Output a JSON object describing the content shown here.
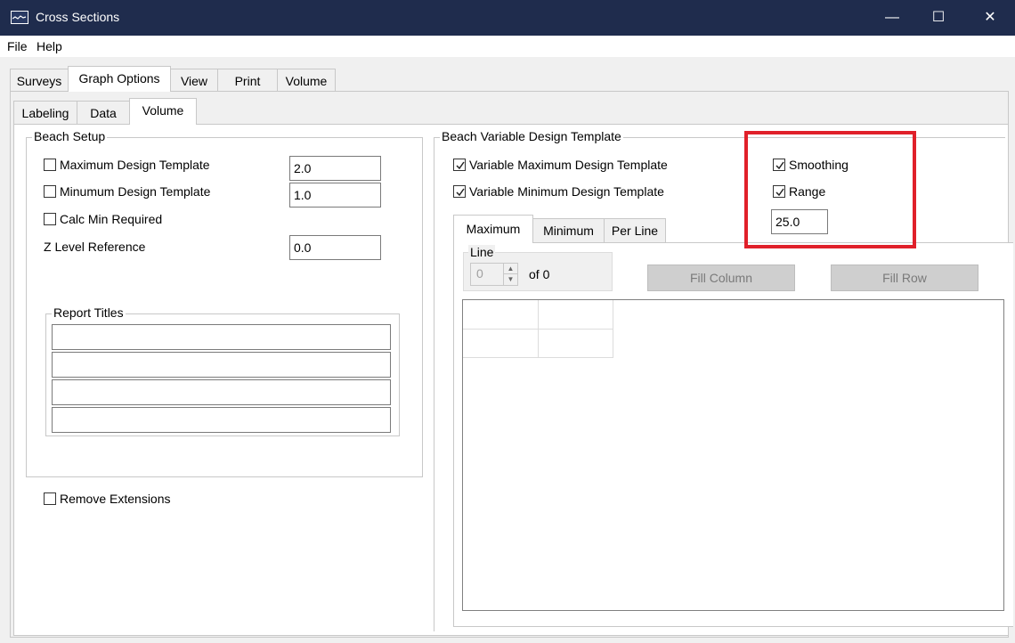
{
  "window": {
    "title": "Cross Sections",
    "minimize": "—",
    "maximize": "☐",
    "close": "✕"
  },
  "menu": [
    "File",
    "Help"
  ],
  "main_tabs": [
    "Surveys",
    "Graph Options",
    "View",
    "Print",
    "Volume"
  ],
  "sub_tabs": [
    "Labeling",
    "Data",
    "Volume"
  ],
  "beach_setup": {
    "legend": "Beach Setup",
    "max_design": {
      "label": "Maximum Design Template",
      "checked": false,
      "value": "2.0"
    },
    "min_design": {
      "label": "Minumum Design Template",
      "checked": false,
      "value": "1.0"
    },
    "calc_min": {
      "label": "Calc Min Required",
      "checked": false
    },
    "z_level": {
      "label": "Z Level Reference",
      "value": "0.0"
    },
    "report_titles": {
      "legend": "Report Titles",
      "lines": [
        "",
        "",
        "",
        ""
      ]
    }
  },
  "remove_extensions": {
    "label": "Remove Extensions",
    "checked": false
  },
  "variable_template": {
    "legend": "Beach Variable Design Template",
    "var_max": {
      "label": "Variable Maximum Design Template",
      "checked": true
    },
    "var_min": {
      "label": "Variable Minimum Design Template",
      "checked": true
    },
    "smoothing": {
      "label": "Smoothing",
      "checked": true
    },
    "range": {
      "label": "Range",
      "checked": true,
      "value": "25.0"
    },
    "tabs": [
      "Maximum",
      "Minimum",
      "Per Line"
    ],
    "line": {
      "legend": "Line",
      "value": "0",
      "of_text": "of 0"
    },
    "fill_column": "Fill Column",
    "fill_row": "Fill Row"
  }
}
